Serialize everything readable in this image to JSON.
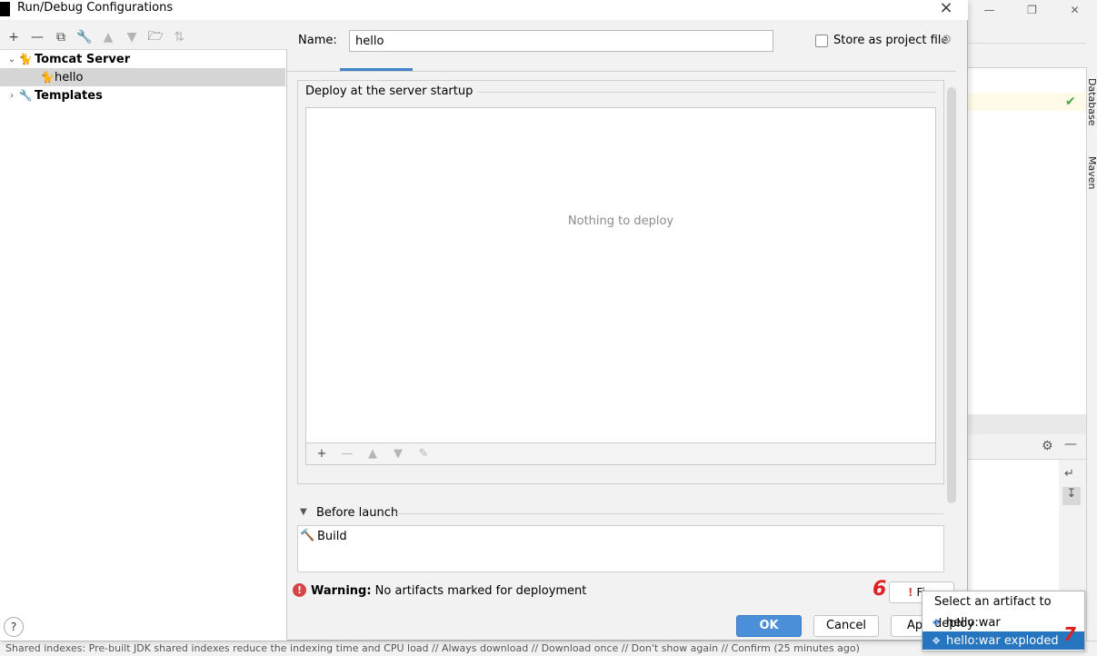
{
  "window": {
    "title": "Run/Debug Configurations"
  },
  "tree": {
    "items": [
      {
        "label": "Tomcat Server",
        "icon": "tomcat-icon",
        "expanded": true
      },
      {
        "label": "hello",
        "icon": "tomcat-config-icon",
        "selected": true
      },
      {
        "label": "Templates",
        "icon": "wrench-icon",
        "expanded": false
      }
    ]
  },
  "form": {
    "name_label": "Name:",
    "name_value": "hello",
    "store_label": "Store as project file",
    "store_checked": false
  },
  "deploy": {
    "title": "Deploy at the server startup",
    "empty_text": "Nothing to deploy"
  },
  "before_launch": {
    "title": "Before launch",
    "items": [
      {
        "label": "Build",
        "icon": "build-hammer-icon"
      }
    ]
  },
  "warning": {
    "bold": "Warning:",
    "text": "No artifacts marked for deployment"
  },
  "buttons": {
    "fix": "Fi",
    "ok": "OK",
    "cancel": "Cancel",
    "apply": "Ap",
    "help": "?"
  },
  "popup": {
    "title": "Select an artifact to deploy",
    "items": [
      {
        "label": "hello:war",
        "selected": false
      },
      {
        "label": "hello:war exploded",
        "selected": true
      }
    ]
  },
  "annotations": {
    "step6": "6",
    "step7": "7"
  },
  "ide": {
    "side_tabs": [
      "Database",
      "Maven"
    ],
    "status_text": "Shared indexes: Pre-built JDK shared indexes reduce the indexing time and CPU load // Always download // Download once // Don't show again // Confirm (25 minutes ago)"
  },
  "colors": {
    "accent": "#4a8fd8",
    "selection": "#2675bf",
    "warning": "#d64545",
    "annotation": "#e02020"
  }
}
